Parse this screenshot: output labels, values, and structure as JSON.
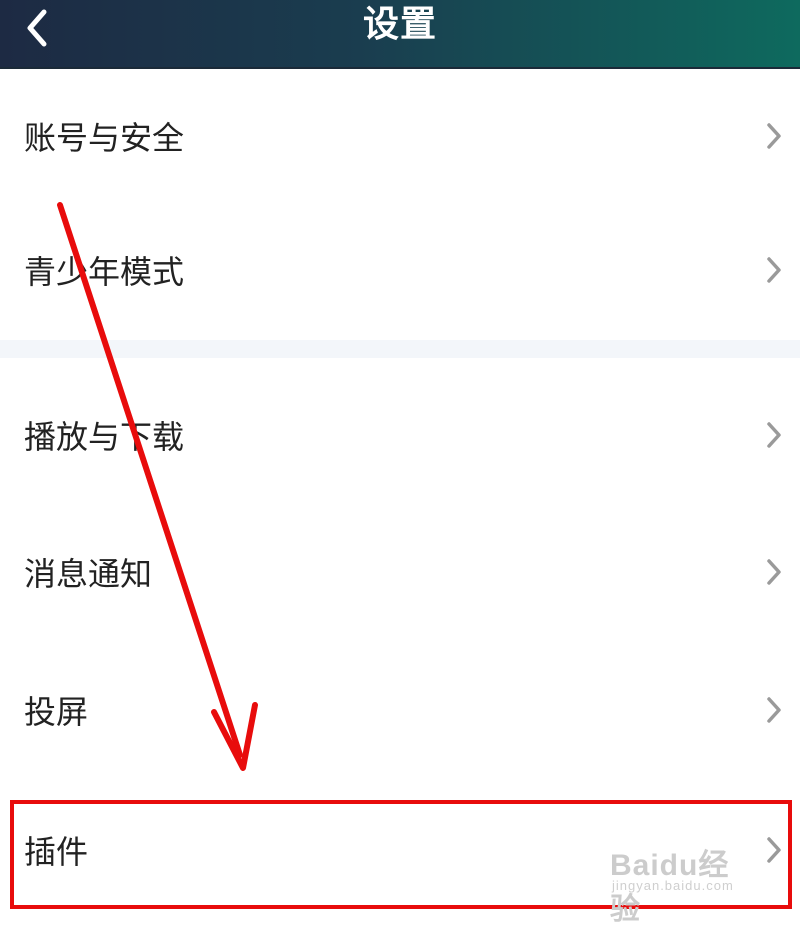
{
  "header": {
    "title": "设置",
    "back_icon": "chevron-left-icon"
  },
  "settings": {
    "items": [
      {
        "label": "账号与安全",
        "icon": "chevron-right-icon"
      },
      {
        "label": "青少年模式",
        "icon": "chevron-right-icon"
      },
      {
        "label": "播放与下载",
        "icon": "chevron-right-icon"
      },
      {
        "label": "消息通知",
        "icon": "chevron-right-icon"
      },
      {
        "label": "投屏",
        "icon": "chevron-right-icon"
      },
      {
        "label": "插件",
        "icon": "chevron-right-icon"
      }
    ]
  },
  "annotation": {
    "arrow_color": "#e80c0c",
    "highlight_color": "#e80c0c",
    "highlighted_item": "插件"
  },
  "watermark": {
    "brand": "Baidu经验",
    "url": "jingyan.baidu.com"
  },
  "colors": {
    "header_start": "#1d2a43",
    "header_end": "#0e6a5e",
    "divider": "#f3f6fa"
  }
}
